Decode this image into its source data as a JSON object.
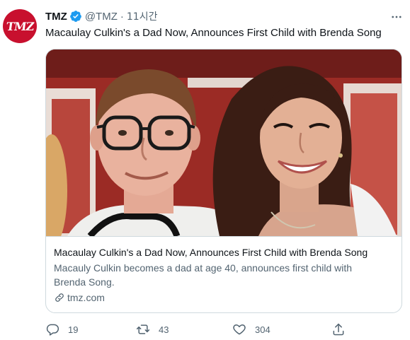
{
  "tweet": {
    "author_name": "TMZ",
    "avatar_text": "TMZ",
    "handle": "@TMZ",
    "separator": "·",
    "timestamp": "11시간",
    "text": "Macaulay Culkin's a Dad Now, Announces First Child with Brenda Song",
    "verified": true
  },
  "card": {
    "title": "Macaulay Culkin's a Dad Now, Announces First Child with Brenda Song",
    "description": "Macauly Culkin becomes a dad at age 40, announces first child with Brenda Song.",
    "domain": "tmz.com",
    "image_icon": "photo"
  },
  "actions": {
    "reply": {
      "icon": "reply-icon",
      "count": "19"
    },
    "retweet": {
      "icon": "retweet-icon",
      "count": "43"
    },
    "like": {
      "icon": "heart-icon",
      "count": "304"
    },
    "share": {
      "icon": "share-icon"
    }
  },
  "colors": {
    "brand_red": "#c8102e",
    "verified_blue": "#1d9bf0",
    "secondary_text": "#536471",
    "border": "#cfd9de"
  }
}
